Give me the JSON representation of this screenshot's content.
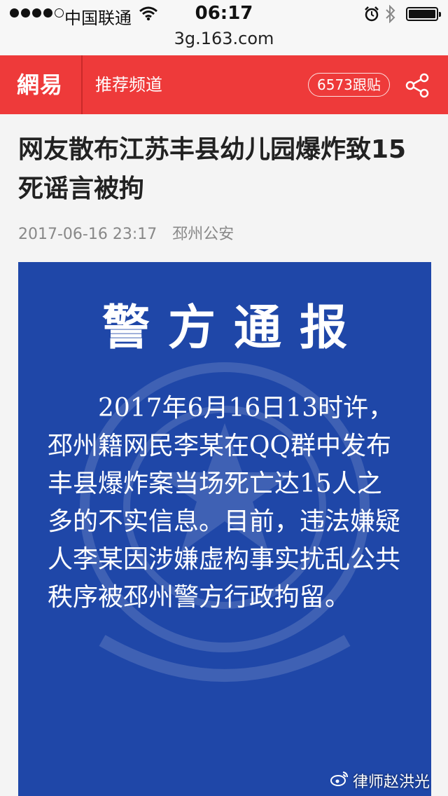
{
  "status_bar": {
    "carrier": "中国联通",
    "time": "06:17",
    "signal_bars_filled": 4,
    "signal_bars_total": 5,
    "icons": [
      "wifi-icon",
      "alarm-icon",
      "bluetooth-icon",
      "battery-icon"
    ]
  },
  "browser": {
    "url": "3g.163.com"
  },
  "header": {
    "logo": "網易",
    "channel": "推荐频道",
    "comments": "6573跟贴",
    "share_icon": "share-icon",
    "accent_color": "#ee3a3a"
  },
  "article": {
    "title": "网友散布江苏丰县幼儿园爆炸致15死谣言被拘",
    "date": "2017-06-16 23:17",
    "source": "邳州公安"
  },
  "notice_image": {
    "title": "警方通报",
    "body": "2017年6月16日13时许，邳州籍网民李某在QQ群中发布丰县爆炸案当场死亡达15人之多的不实信息。目前，违法嫌疑人李某因涉嫌虚构事实扰乱公共秩序被邳州警方行政拘留。",
    "background_color": "#1f47a8"
  },
  "watermark": {
    "text": "律师赵洪光",
    "icon": "weibo-icon"
  }
}
